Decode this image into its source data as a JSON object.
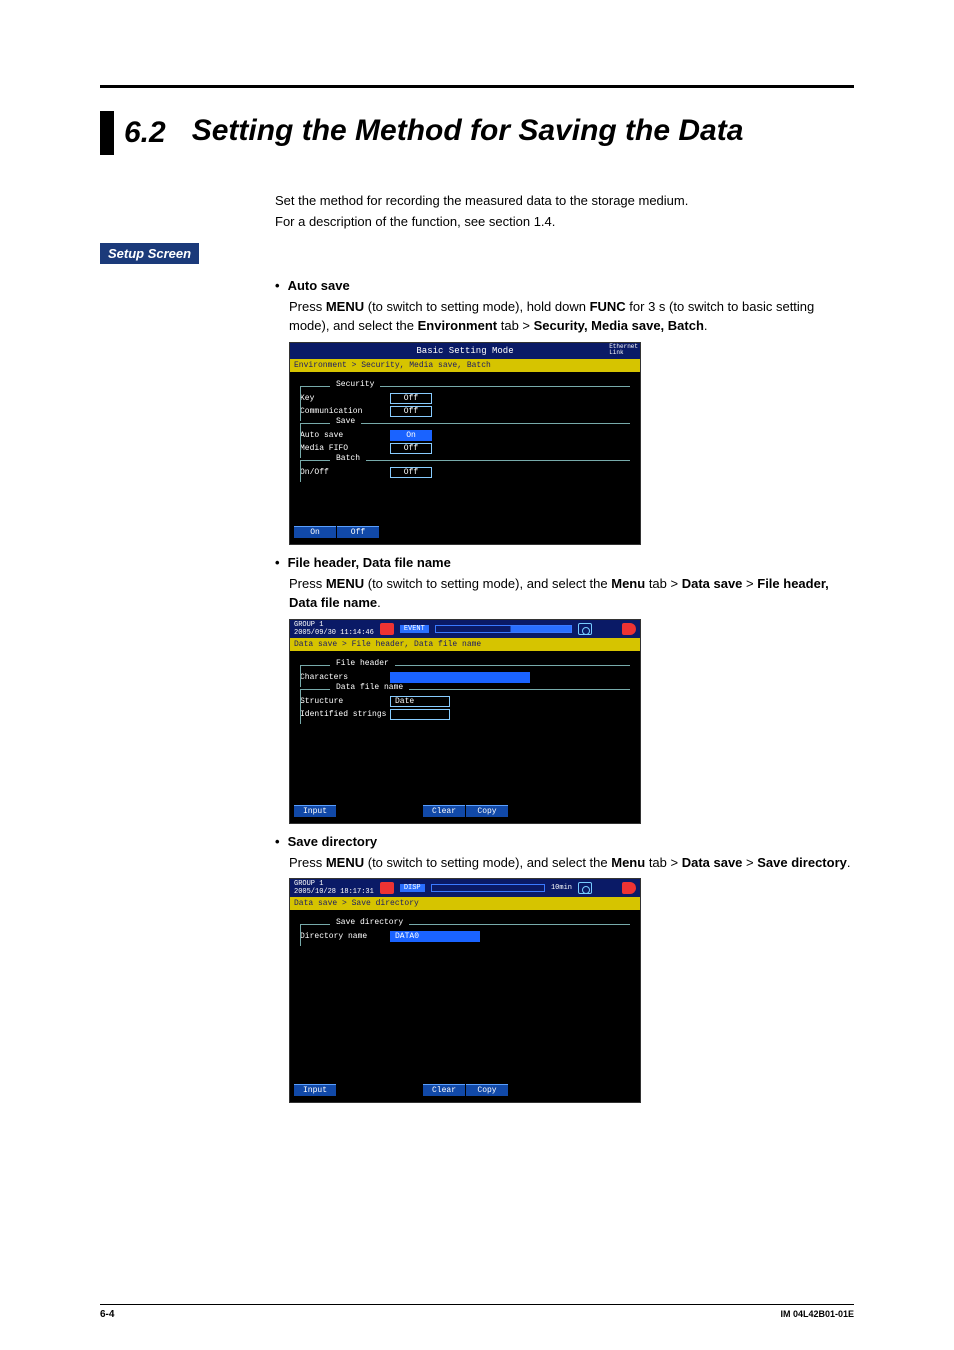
{
  "header": {
    "section_number": "6.2",
    "section_title": "Setting the Method for Saving the Data"
  },
  "intro": {
    "line1": "Set the method for recording the measured data to the storage medium.",
    "line2": "For a description of the function, see section 1.4."
  },
  "setup_label": "Setup Screen",
  "bullets": {
    "auto_save": "Auto save",
    "file_header": "File header, Data file name",
    "save_dir": "Save directory"
  },
  "desc": {
    "auto_save_pre": "Press ",
    "menu": "MENU",
    "auto_save_mid": " (to switch to setting mode), hold down ",
    "func": "FUNC",
    "auto_save_mid2": " for 3 s (to switch to basic setting mode), and select the ",
    "env": "Environment",
    "auto_save_tab_gt": " tab > ",
    "auto_save_path": "Security, Media save, Batch",
    "file_header_mid": " (to switch to setting mode), and select the ",
    "menu_tab": "Menu",
    "ds": "Data save",
    "fh_path": "File header, Data file name",
    "sd_path": "Save directory",
    "period": "."
  },
  "screens": {
    "s1": {
      "title": "Basic Setting Mode",
      "ethernet": "Ethernet\nLink",
      "breadcrumb": "Environment > Security, Media save, Batch",
      "security_legend": "Security",
      "key_lbl": "Key",
      "key_val": "Off",
      "comm_lbl": "Communication",
      "comm_val": "Off",
      "save_legend": "Save",
      "autosave_lbl": "Auto save",
      "autosave_val": "On",
      "mediafifo_lbl": "Media FIFO",
      "mediafifo_val": "Off",
      "batch_legend": "Batch",
      "onoff_lbl": "On/Off",
      "onoff_val": "Off",
      "btn_on": "On",
      "btn_off": "Off"
    },
    "s2": {
      "group": "GROUP 1",
      "datetime": "2005/09/30 11:14:46",
      "tag": "EVENT",
      "breadcrumb": "Data save > File header, Data file name",
      "fh_legend": "File header",
      "chars_lbl": "Characters",
      "dfn_legend": "Data file name",
      "struct_lbl": "Structure",
      "struct_val": "Date",
      "ident_lbl": "Identified strings",
      "btn_input": "Input",
      "btn_clear": "Clear",
      "btn_copy": "Copy"
    },
    "s3": {
      "group": "GROUP 1",
      "datetime": "2005/10/28 18:17:31",
      "tag": "DISP",
      "dur": "10min",
      "breadcrumb": "Data save > Save directory",
      "sd_legend": "Save directory",
      "dir_lbl": "Directory name",
      "dir_val": "DATA0",
      "btn_input": "Input",
      "btn_clear": "Clear",
      "btn_copy": "Copy"
    }
  },
  "footer": {
    "page": "6-4",
    "doc": "IM 04L42B01-01E"
  }
}
